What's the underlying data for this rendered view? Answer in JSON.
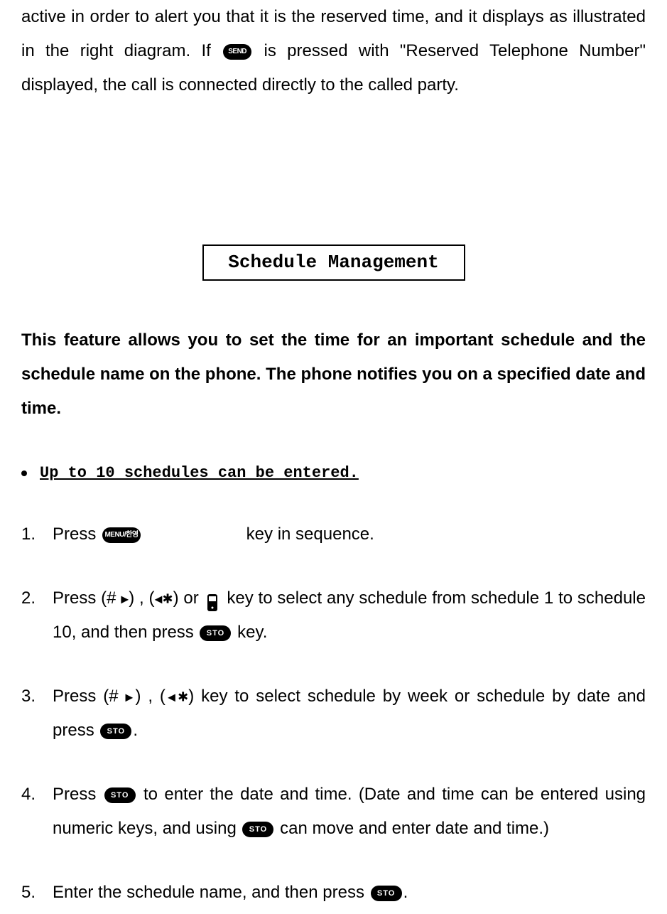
{
  "intro": {
    "part1": "active in order to alert you that it is the reserved time, and it displays as illustrated in the right diagram. If ",
    "sendLabel": "SEND",
    "part2": " is pressed with \"Reserved Telephone Number\" displayed, the call is connected directly to the called party."
  },
  "sectionTitle": "Schedule Management",
  "featureDesc": "This feature allows you to set the time for an important schedule and the schedule name on the phone. The phone notifies you on a specified date and time.",
  "bulletNote": "Up to 10 schedules can be entered.",
  "buttons": {
    "menu": "MENU/한영",
    "sto": "STO"
  },
  "steps": {
    "s1": {
      "a": "Press ",
      "b": " key in sequence."
    },
    "s2": {
      "a": "Press (# ",
      "b": ") , (",
      "c": ") or  ",
      "d": " key to select any schedule from schedule 1 to schedule 10, and then press ",
      "e": " key."
    },
    "s3": {
      "a": "Press (# ",
      "b": ") , (",
      "c": ") key to select schedule by week or schedule by date and press ",
      "d": "."
    },
    "s4": {
      "a": "Press ",
      "b": " to enter the date and time. (Date and time can be entered using numeric keys, and using ",
      "c": " can move and enter date and time.)"
    },
    "s5": {
      "a": "Enter the schedule name, and then press ",
      "b": "."
    }
  },
  "glyphs": {
    "triRight": "▶",
    "triLeft": "◀",
    "star": "✱"
  }
}
